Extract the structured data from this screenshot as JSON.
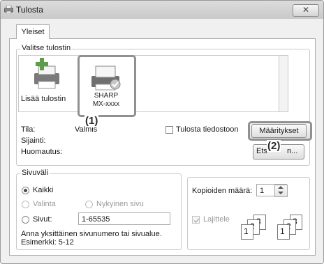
{
  "window": {
    "title": "Tulosta",
    "close_glyph": "✕"
  },
  "tabs": [
    {
      "label": "Yleiset"
    }
  ],
  "select_printer": {
    "legend": "Valitse tulostin",
    "printers": [
      {
        "name": "Lisää tulostin",
        "icon": "add-printer-icon"
      },
      {
        "name_line1": "SHARP",
        "name_line2": "MX-xxxx",
        "icon": "printer-icon",
        "selected": true
      }
    ],
    "status_label": "Tila:",
    "status_value": "Valmis",
    "location_label": "Sijainti:",
    "location_value": "",
    "comment_label": "Huomautus:",
    "comment_value": "",
    "print_to_file_label": "Tulosta tiedostoon",
    "preferences_button": "Määritykset",
    "find_button_left": "Ets",
    "find_button_right": "n..."
  },
  "callouts": {
    "c1": "(1)",
    "c2": "(2)"
  },
  "page_range": {
    "legend": "Sivuväli",
    "all": "Kaikki",
    "selection": "Valinta",
    "current_page": "Nykyinen sivu",
    "pages": "Sivut:",
    "pages_value": "1-65535",
    "hint_line1": "Anna yksittäinen sivunumero tai sivualue.",
    "hint_line2": "Esimerkki: 5-12"
  },
  "copies": {
    "label": "Kopioiden määrä:",
    "value": "1",
    "collate_label": "Lajittele",
    "collate_pages": [
      "1",
      "2",
      "3"
    ]
  },
  "colors": {
    "accent_border": "#909090"
  }
}
